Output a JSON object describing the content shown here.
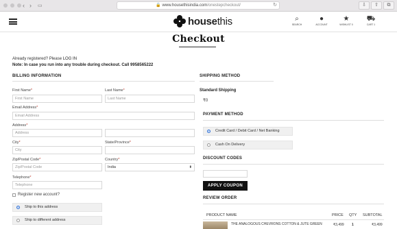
{
  "browser": {
    "url_host": "www.housethisindia.com",
    "url_path": "/onestepcheckout/"
  },
  "site": {
    "logo_text_bold": "house",
    "logo_text_rest": "this",
    "nav": [
      {
        "label": "SEARCH",
        "icon": "search-icon"
      },
      {
        "label": "ACCOUNT",
        "icon": "account-icon"
      },
      {
        "label": "WISHLIST 0",
        "icon": "star-icon"
      },
      {
        "label": "CART 1",
        "icon": "cart-icon"
      }
    ]
  },
  "page": {
    "title": "Checkout",
    "registered_prefix": "Already registered? Please ",
    "login_link": "LOG IN",
    "note": "Note: In case you run into any trouble during checkout. Call 9958565222"
  },
  "billing": {
    "heading": "BILLING INFORMATION",
    "first_name_label": "First Name",
    "first_name_placeholder": "First Name",
    "last_name_label": "Last Name",
    "last_name_placeholder": "Last Name",
    "email_label": "Email Address",
    "email_placeholder": "Email Address",
    "address_label": "Address",
    "address_placeholder": "Address",
    "city_label": "City",
    "city_placeholder": "City",
    "state_label": "State/Province",
    "postal_label": "Zip/Postal Code",
    "postal_placeholder": "Zip/Postal Code",
    "country_label": "Country",
    "country_value": "India",
    "telephone_label": "Telephone",
    "telephone_placeholder": "Telephone",
    "register_label": "Register new account?",
    "ship_same": "Ship to this address",
    "ship_different": "Ship to different address",
    "required_mark": "*"
  },
  "shipping": {
    "heading": "SHIPPING METHOD",
    "method": "Standard Shipping",
    "price": "₹0"
  },
  "payment": {
    "heading": "PAYMENT METHOD",
    "options": [
      {
        "label": "Credit Card / Debit Card / Net Banking",
        "selected": true
      },
      {
        "label": "Cash On Delivery",
        "selected": false
      }
    ]
  },
  "discount": {
    "heading": "DISCOUNT CODES",
    "apply_label": "APPLY COUPON"
  },
  "review": {
    "heading": "REVIEW ORDER",
    "columns": [
      "PRODUCT NAME",
      "PRICE",
      "QTY",
      "SUBTOTAL"
    ],
    "rows": [
      {
        "name": "THE ANALOGOUS CHEVRONS COTTON & JUTE GREEN",
        "price": "₹3,499",
        "qty": "1",
        "subtotal": "₹3,499"
      }
    ]
  }
}
